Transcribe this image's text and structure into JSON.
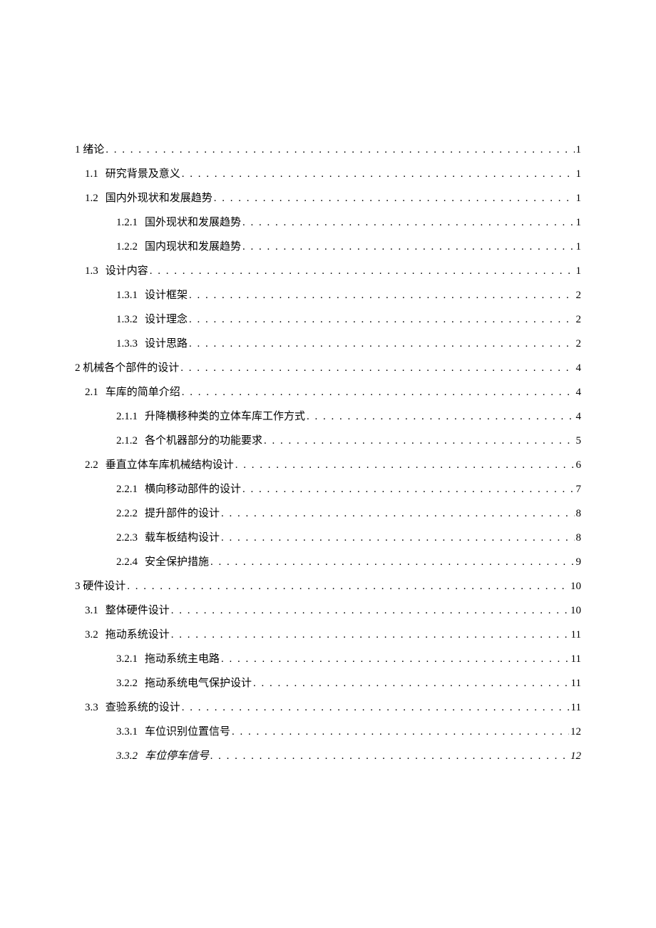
{
  "toc": [
    {
      "level": 1,
      "num": "1",
      "title": "绪论",
      "page": "1",
      "italic": false,
      "joinNum": true
    },
    {
      "level": 2,
      "num": "1.1",
      "title": "研究背景及意义",
      "page": "1",
      "italic": false
    },
    {
      "level": 2,
      "num": "1.2",
      "title": "国内外现状和发展趋势",
      "page": "1",
      "italic": false
    },
    {
      "level": 3,
      "num": "1.2.1",
      "title": "国外现状和发展趋势",
      "page": "1",
      "italic": false
    },
    {
      "level": 3,
      "num": "1.2.2",
      "title": "国内现状和发展趋势",
      "page": "1",
      "italic": false
    },
    {
      "level": 2,
      "num": "1.3",
      "title": "设计内容",
      "page": "1",
      "italic": false
    },
    {
      "level": 3,
      "num": "1.3.1",
      "title": "设计框架",
      "page": "2",
      "italic": false
    },
    {
      "level": 3,
      "num": "1.3.2",
      "title": "设计理念",
      "page": "2",
      "italic": false
    },
    {
      "level": 3,
      "num": "1.3.3",
      "title": "设计思路",
      "page": "2",
      "italic": false
    },
    {
      "level": 1,
      "num": "2",
      "title": "机械各个部件的设计",
      "page": "4",
      "italic": false,
      "joinNum": true
    },
    {
      "level": 2,
      "num": "2.1",
      "title": "车库的简单介绍",
      "page": "4",
      "italic": false
    },
    {
      "level": 3,
      "num": "2.1.1",
      "title": "升降横移种类的立体车库工作方式",
      "page": "4",
      "italic": false
    },
    {
      "level": 3,
      "num": "2.1.2",
      "title": "各个机器部分的功能要求",
      "page": "5",
      "italic": false
    },
    {
      "level": 2,
      "num": "2.2",
      "title": "垂直立体车库机械结构设计",
      "page": "6",
      "italic": false
    },
    {
      "level": 3,
      "num": "2.2.1",
      "title": "横向移动部件的设计",
      "page": "7",
      "italic": false
    },
    {
      "level": 3,
      "num": "2.2.2",
      "title": "提升部件的设计",
      "page": "8",
      "italic": false
    },
    {
      "level": 3,
      "num": "2.2.3",
      "title": "载车板结构设计",
      "page": "8",
      "italic": false
    },
    {
      "level": 3,
      "num": "2.2.4",
      "title": "安全保护措施",
      "page": "9",
      "italic": false
    },
    {
      "level": 1,
      "num": "3",
      "title": "硬件设计",
      "page": "10",
      "italic": false,
      "joinNum": true
    },
    {
      "level": 2,
      "num": "3.1",
      "title": "整体硬件设计",
      "page": "10",
      "italic": false
    },
    {
      "level": 2,
      "num": "3.2",
      "title": "拖动系统设计",
      "page": "11",
      "italic": false
    },
    {
      "level": 3,
      "num": "3.2.1",
      "title": "拖动系统主电路",
      "page": "11",
      "italic": false
    },
    {
      "level": 3,
      "num": "3.2.2",
      "title": "拖动系统电气保护设计",
      "page": "11",
      "italic": false
    },
    {
      "level": 2,
      "num": "3.3",
      "title": "查验系统的设计",
      "page": "11",
      "italic": false
    },
    {
      "level": 3,
      "num": "3.3.1",
      "title": "车位识别位置信号",
      "page": "12",
      "italic": false
    },
    {
      "level": 3,
      "num": "3.3.2",
      "title": "车位停车信号",
      "page": "12",
      "italic": true
    }
  ]
}
